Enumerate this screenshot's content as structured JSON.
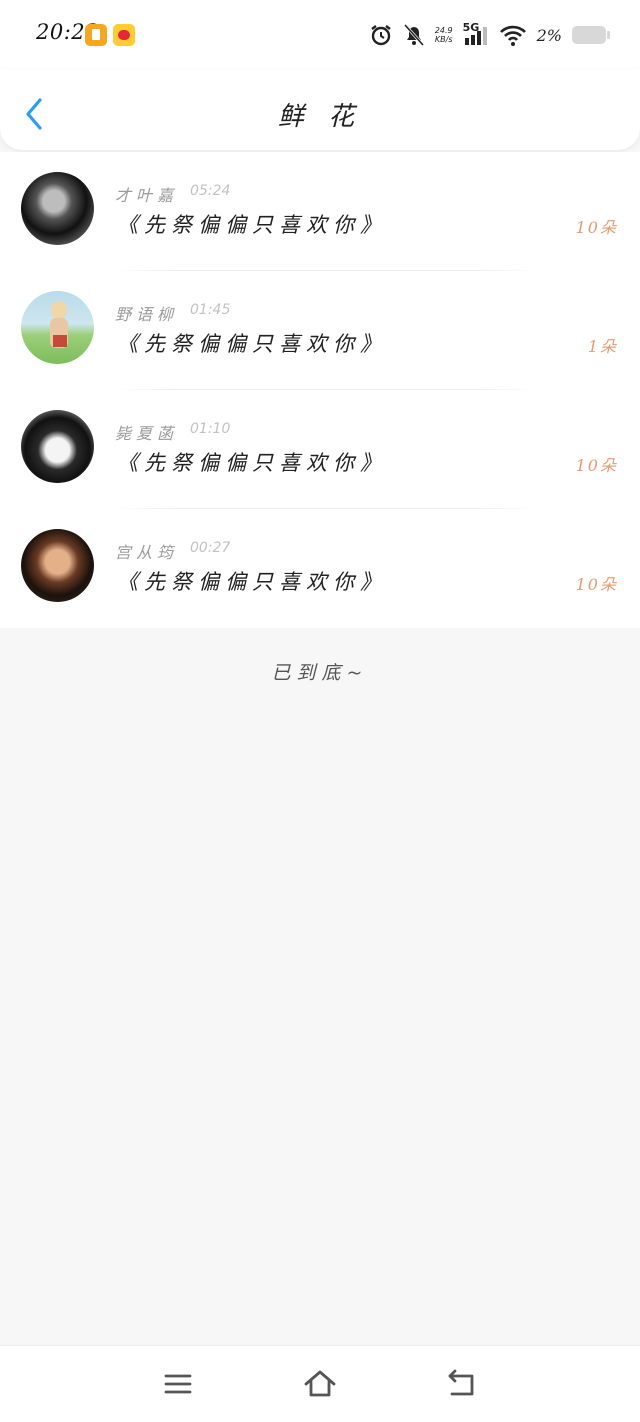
{
  "status_bar": {
    "time": "20:23",
    "net_speed_value": "24.9",
    "net_speed_unit": "KB/s",
    "network": "5G",
    "battery": "2%"
  },
  "header": {
    "title": "鲜 花",
    "back_icon": "chevron-left-icon"
  },
  "items": [
    {
      "name": "才叶嘉",
      "time": "05:24",
      "message": "《先祭偏偏只喜欢你》",
      "count": "10朵"
    },
    {
      "name": "野语柳",
      "time": "01:45",
      "message": "《先祭偏偏只喜欢你》",
      "count": "1朵"
    },
    {
      "name": "毙夏菡",
      "time": "01:10",
      "message": "《先祭偏偏只喜欢你》",
      "count": "10朵"
    },
    {
      "name": "宫从筠",
      "time": "00:27",
      "message": "《先祭偏偏只喜欢你》",
      "count": "10朵"
    }
  ],
  "footer_text": "已到底~",
  "nav": {
    "menu_icon": "menu-icon",
    "home_icon": "home-icon",
    "back_icon": "return-icon"
  },
  "colors": {
    "accent": "#2a9df4",
    "count": "#e49b6f",
    "background": "#f8f7f8"
  }
}
